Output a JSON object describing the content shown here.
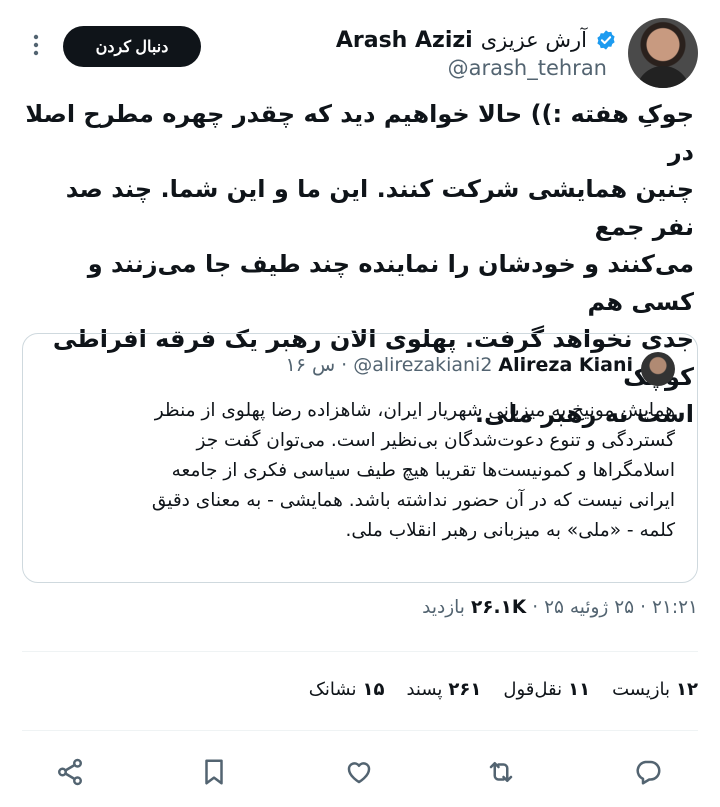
{
  "author": {
    "name_latin": "Arash Azizi",
    "name_fa": "آرش عزیزی",
    "handle": "@arash_tehran",
    "follow_label": "دنبال کردن"
  },
  "tweet": {
    "text": "جوکِ هفته :)) حالا خواهیم دید که چقدر چهره مطرح اصلا در\nچنین همایشی شرکت کنند. این ما و این شما. چند صد نفر جمع\nمی‌کنند و خودشان را نماینده چند طیف جا می‌زنند و کسی هم\nجدی نخواهد گرفت. پهلوی الان رهبر یک فرقه افراطی کوچک\nاست نه رهبر ملی."
  },
  "quote": {
    "name": "Alireza Kiani",
    "handle": "@alirezakiani2",
    "time": "۱۶ س",
    "separator": "·",
    "text": "همایش مونیخ به میزبانی شهریار ایران، شاهزاده رضا پهلوی از منظر\nگستردگی و تنوع دعوت‌شدگان بی‌نظیر است. می‌توان گفت جز\nاسلامگراها و کمونیست‌ها تقریبا هیچ طیف سیاسی فکری از جامعه\nایرانی نیست که در آن حضور نداشته باشد. همایشی - به معنای دقیق\nکلمه - «ملی» به میزبانی رهبر انقلاب ملی."
  },
  "meta": {
    "time": "۲۱:۲۱",
    "date": "۲۵ ژوئیه ۲۵",
    "views_count": "۲۶.۱K",
    "views_label": "بازدید",
    "dot": "·"
  },
  "stats": [
    {
      "num": "۱۲",
      "label": "بازیست"
    },
    {
      "num": "۱۱",
      "label": "نقل‌قول"
    },
    {
      "num": "۲۶۱",
      "label": "پسند"
    },
    {
      "num": "۱۵",
      "label": "نشانک"
    }
  ],
  "actions": [
    "reply-icon",
    "retweet-icon",
    "like-icon",
    "bookmark-icon",
    "share-icon"
  ]
}
